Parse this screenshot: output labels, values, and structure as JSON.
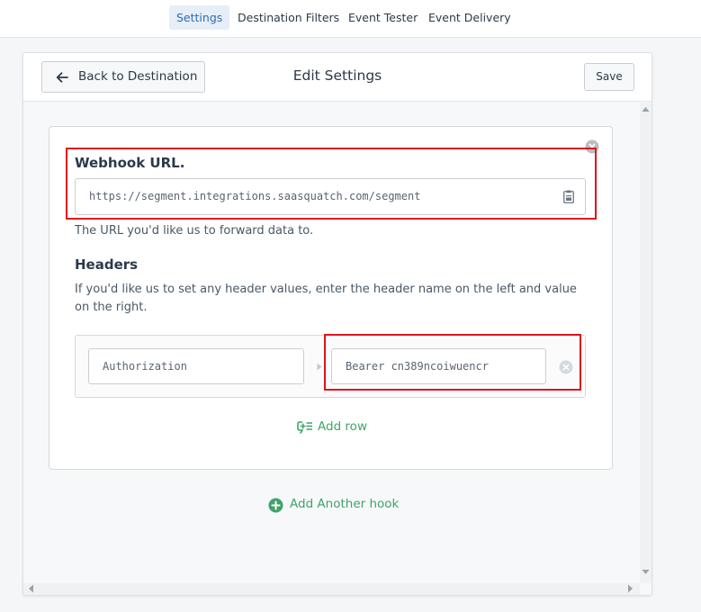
{
  "nav": {
    "tabs": [
      {
        "label": "Settings",
        "active": true
      },
      {
        "label": "Destination Filters",
        "active": false
      },
      {
        "label": "Event Tester",
        "active": false
      },
      {
        "label": "Event Delivery",
        "active": false
      }
    ]
  },
  "header": {
    "back_label": "Back to Destination",
    "title": "Edit Settings",
    "save_label": "Save"
  },
  "webhook": {
    "label": "Webhook URL.",
    "url_value": "https://segment.integrations.saasquatch.com/segment",
    "help": "The URL you'd like us to forward data to."
  },
  "headers": {
    "label": "Headers",
    "help": "If you'd like us to set any header values, enter the header name on the left and value on the right.",
    "rows": [
      {
        "name": "Authorization",
        "value": "Bearer cn389ncoiwuencr"
      }
    ],
    "add_row_label": "Add row"
  },
  "add_hook_label": "Add Another hook",
  "colors": {
    "accent_blue": "#2f6bb3",
    "green": "#3fa36a",
    "highlight_red": "#e0141e"
  },
  "icons": {
    "back": "arrow-left-icon",
    "clipboard": "clipboard-icon",
    "remove": "close-circle-icon",
    "add_row": "add-row-icon",
    "add_hook": "plus-circle-icon"
  }
}
